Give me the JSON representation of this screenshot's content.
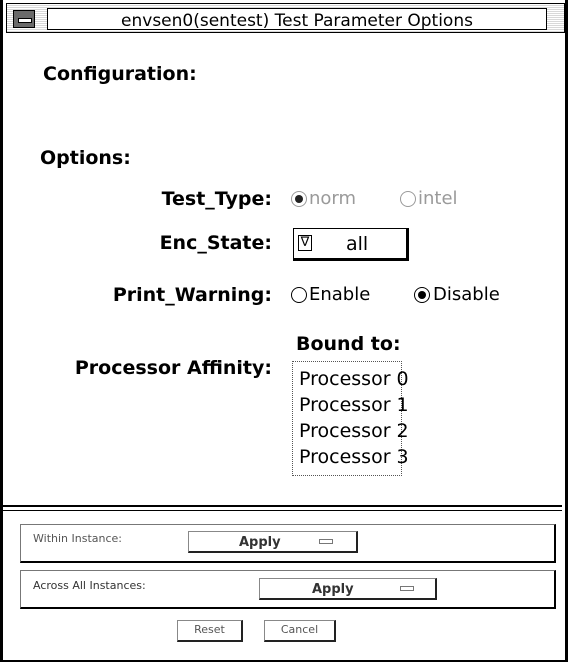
{
  "window": {
    "title": "envsen0(sentest) Test Parameter Options"
  },
  "sections": {
    "configuration": "Configuration:",
    "options": "Options:"
  },
  "test_type": {
    "label": "Test_Type:",
    "options": [
      "norm",
      "intel"
    ],
    "selected": "norm"
  },
  "enc_state": {
    "label": "Enc_State:",
    "arrow": "∇",
    "value": "all"
  },
  "print_warning": {
    "label": "Print_Warning:",
    "options": [
      "Enable",
      "Disable"
    ],
    "selected": "Disable"
  },
  "processor_affinity": {
    "label": "Processor Affinity:",
    "bound_label": "Bound to:",
    "items": [
      "Processor 0",
      "Processor 1",
      "Processor 2",
      "Processor 3"
    ]
  },
  "within_instance": {
    "label": "Within Instance:",
    "button": "Apply"
  },
  "across_instances": {
    "label": "Across All Instances:",
    "button": "Apply"
  },
  "buttons": {
    "reset": "Reset",
    "cancel": "Cancel"
  }
}
